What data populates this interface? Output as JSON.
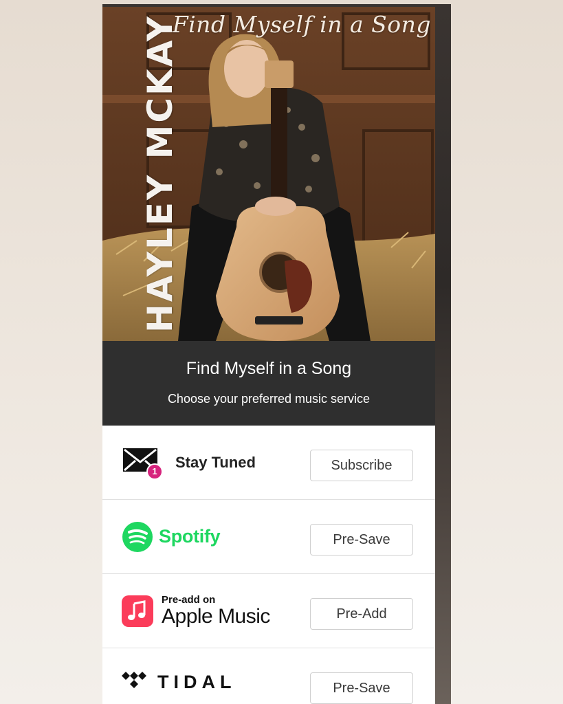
{
  "cover": {
    "script_title": "Find Myself in a Song",
    "artist": "HAYLEY MCKAY"
  },
  "release": {
    "title": "Find Myself in a Song",
    "subtitle": "Choose your preferred music service"
  },
  "services": [
    {
      "id": "stay-tuned",
      "label": "Stay Tuned",
      "badge": "1",
      "button": "Subscribe",
      "icon": "mail-icon"
    },
    {
      "id": "spotify",
      "label": "Spotify",
      "button": "Pre-Save",
      "icon": "spotify-icon"
    },
    {
      "id": "apple-music",
      "label_small": "Pre-add on",
      "label": "Apple Music",
      "button": "Pre-Add",
      "icon": "apple-music-icon"
    },
    {
      "id": "tidal",
      "label": "TIDAL",
      "button": "Pre-Save",
      "icon": "tidal-icon"
    }
  ],
  "colors": {
    "header_bg": "#2f2f2f",
    "spotify_green": "#1ed760",
    "apple_red": "#fb3c5a",
    "badge_pink": "#d6247d"
  }
}
